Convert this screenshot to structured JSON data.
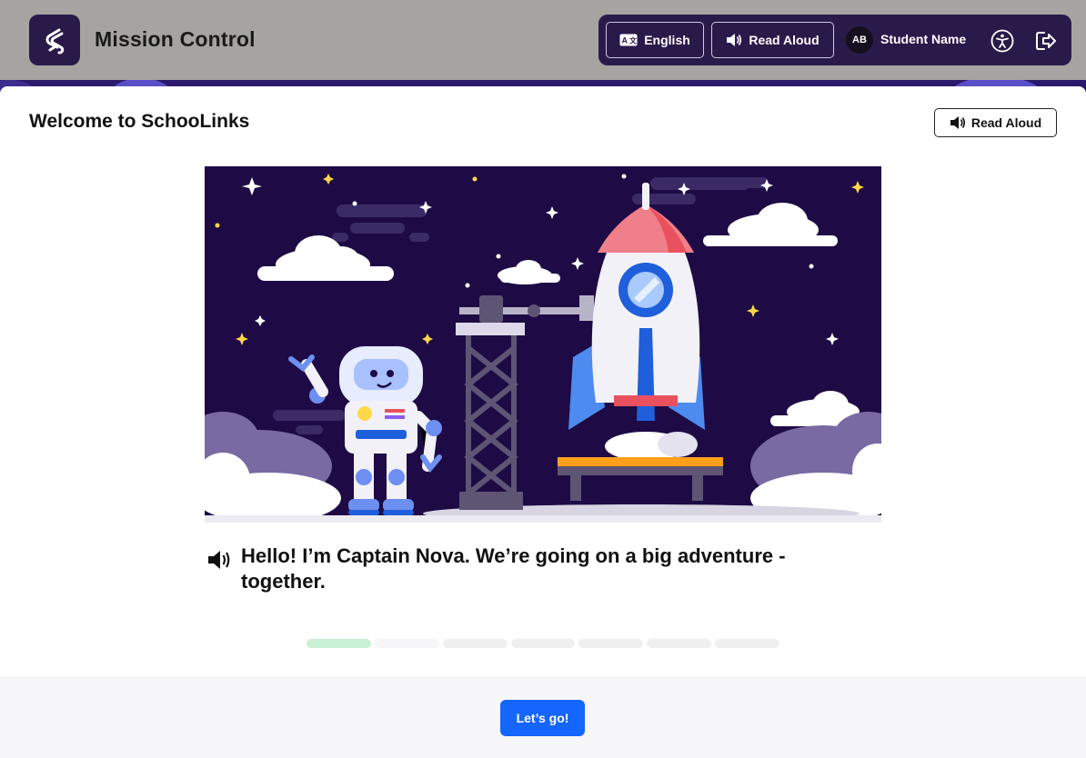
{
  "header": {
    "app_title": "Mission Control",
    "language_label": "English",
    "read_aloud_label": "Read Aloud",
    "avatar_initials": "AB",
    "student_name": "Student Name"
  },
  "modal": {
    "title": "Welcome to SchooLinks",
    "read_aloud_label": "Read Aloud",
    "speech_text": "Hello! I’m Captain Nova. We’re going on a big adventure - together.",
    "progress": {
      "total_steps": 7,
      "current_step": 1
    },
    "primary_button_label": "Let’s go!"
  },
  "colors": {
    "brand_dark": "#2a1a4a",
    "primary_button": "#1565ff",
    "progress_active": "#c9f1d3",
    "progress_inactive": "#efefef",
    "illustration_sky": "#1e0b45"
  }
}
